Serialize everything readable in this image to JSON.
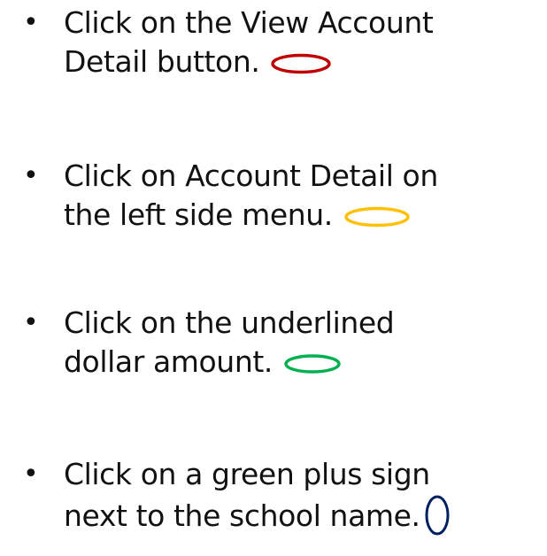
{
  "bullets": [
    {
      "line1": "Click on the View Account",
      "line2": "Detail button.",
      "marker": {
        "shape": "ellipse-outline",
        "color": "#c00000"
      }
    },
    {
      "line1": "Click on Account Detail on",
      "line2": "the left side menu.",
      "marker": {
        "shape": "ellipse-outline",
        "color": "#ffc000"
      }
    },
    {
      "line1": "Click on the underlined",
      "line2": "dollar amount.",
      "marker": {
        "shape": "ellipse-outline",
        "color": "#00b050"
      }
    },
    {
      "line1": "Click on a green plus sign",
      "line2": "next to the school name.",
      "marker": {
        "shape": "circle-outline",
        "color": "#002060"
      }
    }
  ],
  "bullet_glyph": "•"
}
